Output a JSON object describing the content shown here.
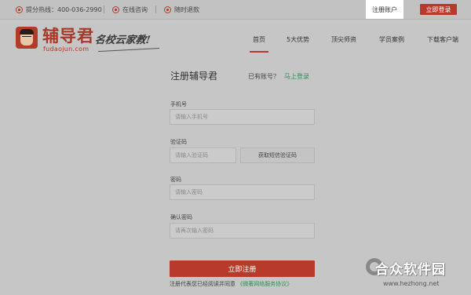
{
  "topbar": {
    "hotline": "提分热线：400-036-2990",
    "consult": "在线咨询",
    "refund": "随时退款",
    "register": "注册账户",
    "login": "立即登录"
  },
  "logo": {
    "name": "辅导君",
    "url": "fudaojun.com",
    "slogan": "名校云家教!"
  },
  "nav": [
    "首页",
    "5大优势",
    "顶尖师资",
    "学员案例",
    "下载客户端"
  ],
  "form": {
    "title": "注册辅导君",
    "has_account": "已有账号？",
    "login_now": "马上登录",
    "phone_label": "手机号",
    "phone_placeholder": "请输入手机号",
    "code_label": "验证码",
    "code_placeholder": "请输入验证码",
    "sms_button": "获取短信验证码",
    "password_label": "密码",
    "password_placeholder": "请输入密码",
    "confirm_label": "确认密码",
    "confirm_placeholder": "请再次输入密码",
    "submit": "立即注册",
    "agree_text": "注册代表您已经阅读并同意",
    "agree_link": "《微著网络服务协议》"
  },
  "watermark": {
    "name": "合众软件园",
    "url": "www.hezhong.net"
  },
  "colors": {
    "brand_red": "#b83a2c",
    "link_green": "#2f8f5b",
    "overlay_gray": "#c6c6c6"
  }
}
